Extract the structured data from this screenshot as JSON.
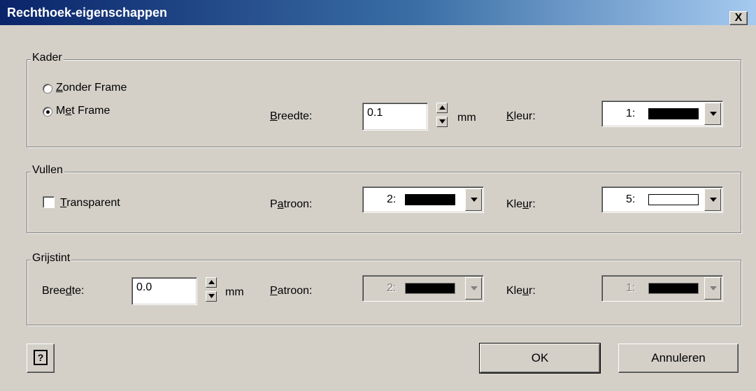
{
  "window": {
    "title": "Rechthoek-eigenschappen",
    "close_label": "X"
  },
  "kader": {
    "label": "Kader",
    "radio_no_frame": {
      "pre": "",
      "mn": "Z",
      "post": "onder Frame",
      "selected": false
    },
    "radio_frame": {
      "pre": "M",
      "mn": "e",
      "post": "t Frame",
      "selected": true
    },
    "width_label": {
      "pre": "",
      "mn": "B",
      "post": "reedte:"
    },
    "width_value": "0.1",
    "unit": "mm",
    "color_label": {
      "pre": "",
      "mn": "K",
      "post": "leur:"
    },
    "color_value": "1:",
    "color_swatch": "#000000"
  },
  "vullen": {
    "label": "Vullen",
    "checkbox_transparent": {
      "pre": "",
      "mn": "T",
      "post": "ransparent",
      "checked": false
    },
    "pattern_label": {
      "pre": "P",
      "mn": "a",
      "post": "troon:"
    },
    "pattern_value": "2:",
    "pattern_swatch": "#000000",
    "color_label": {
      "pre": "Kle",
      "mn": "u",
      "post": "r:"
    },
    "color_value": "5:",
    "color_swatch": "#ffffff"
  },
  "grijstint": {
    "label": "Grijstint",
    "width_label": {
      "pre": "Bree",
      "mn": "d",
      "post": "te:"
    },
    "width_value": "0.0",
    "unit": "mm",
    "pattern_label": {
      "pre": "",
      "mn": "P",
      "post": "atroon:"
    },
    "pattern_value": "2:",
    "pattern_swatch": "#000000",
    "color_label": {
      "pre": "Kle",
      "mn": "u",
      "post": "r:"
    },
    "color_value": "1:",
    "color_swatch": "#000000"
  },
  "buttons": {
    "help_icon": "?",
    "ok": "OK",
    "cancel": "Annuleren"
  }
}
